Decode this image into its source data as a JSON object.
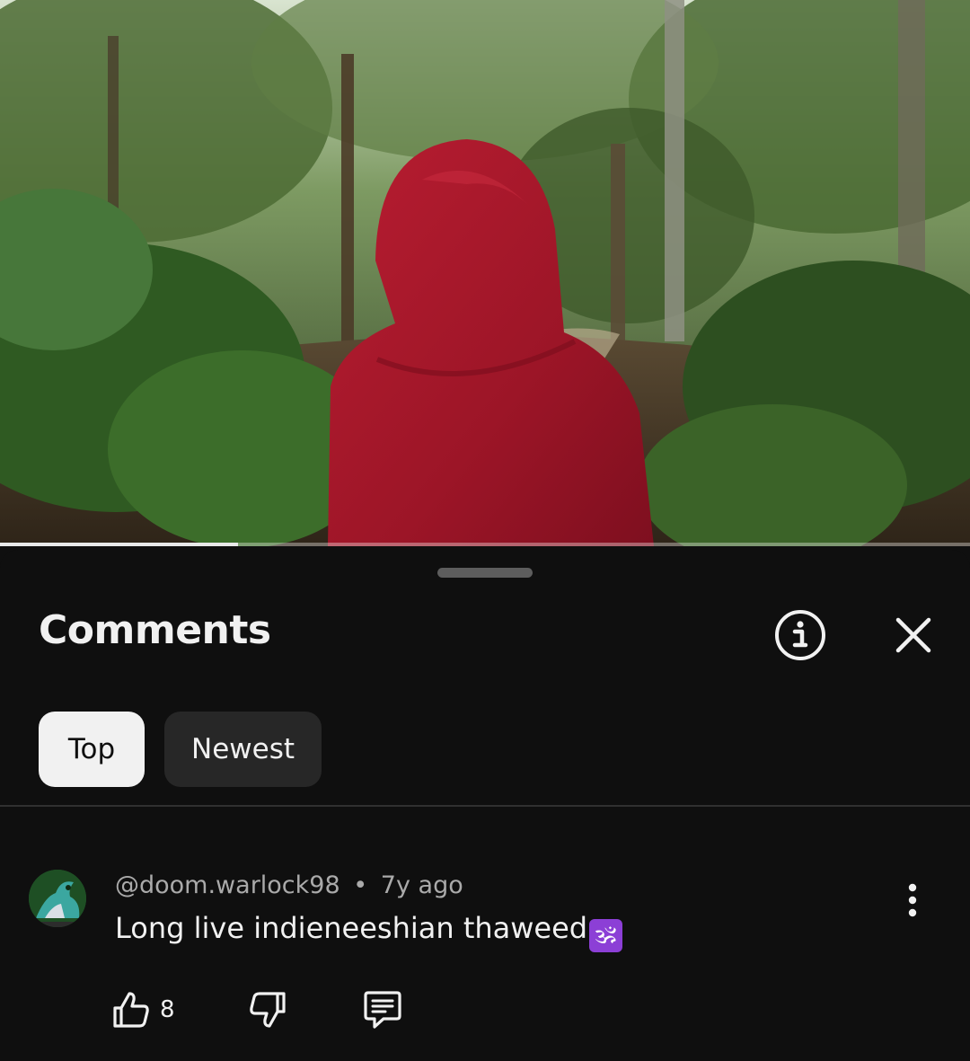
{
  "player": {
    "progress_fraction": 0.245
  },
  "comments_panel": {
    "title": "Comments",
    "info_icon": "info-circle-icon",
    "close_icon": "close-icon",
    "sort_chips": [
      {
        "label": "Top",
        "selected": true
      },
      {
        "label": "Newest",
        "selected": false
      }
    ]
  },
  "comments": [
    {
      "author": "@doom.warlock98",
      "separator": "•",
      "time": "7y ago",
      "text": "Long live indieneeshian thaweed",
      "emoji": "🕉",
      "likes": "8",
      "icons": {
        "like": "thumbs-up-icon",
        "dislike": "thumbs-down-icon",
        "reply": "reply-comment-icon",
        "more": "more-vertical-icon"
      }
    }
  ],
  "colors": {
    "background": "#0f0f0f",
    "chip_selected_bg": "#f1f1f1",
    "chip_bg": "#272727",
    "secondary_text": "#aaaaaa",
    "robe_red": "#a3172a",
    "emoji_badge": "#8c3fd6"
  }
}
